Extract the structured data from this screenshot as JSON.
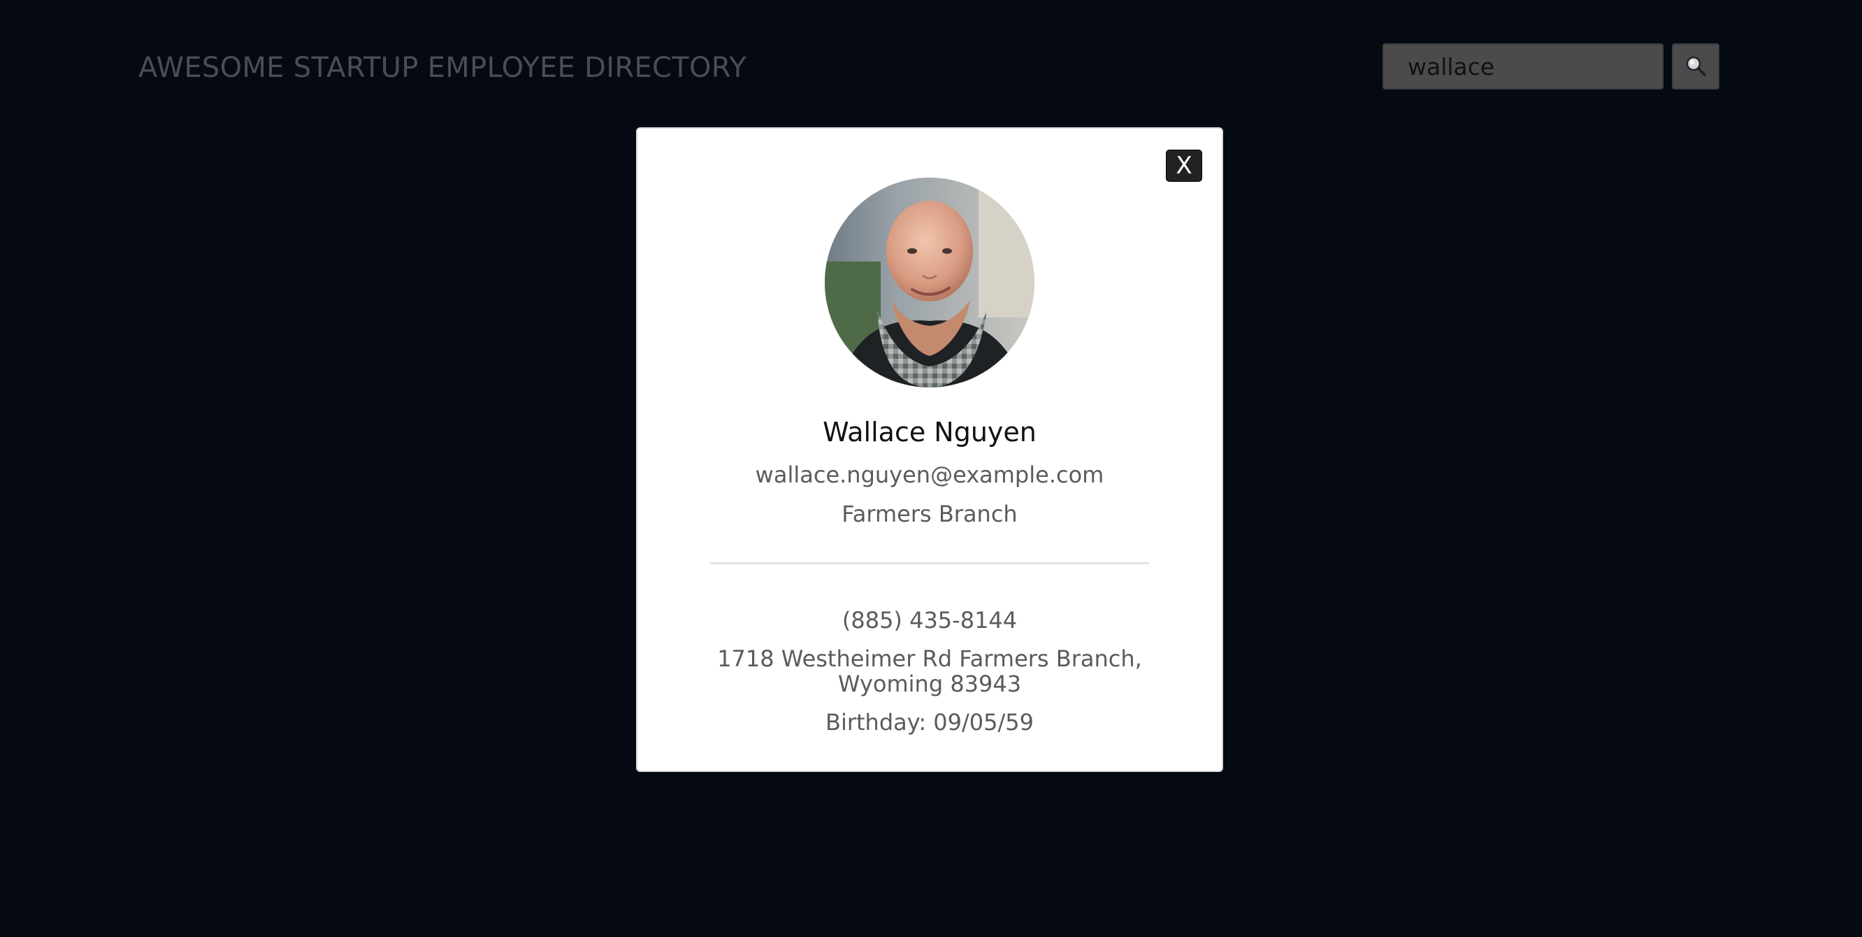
{
  "header": {
    "title": "AWESOME STARTUP EMPLOYEE DIRECTORY"
  },
  "search": {
    "value": "wallace",
    "button_icon": "search-icon"
  },
  "modal": {
    "close_label": "X",
    "employee": {
      "name": "Wallace Nguyen",
      "email": "wallace.nguyen@example.com",
      "city": "Farmers Branch",
      "phone": "(885) 435-8144",
      "address": "1718 Westheimer Rd Farmers Branch, Wyoming 83943",
      "birthday": "Birthday: 09/05/59"
    }
  },
  "colors": {
    "background": "#050912",
    "modal": "#ffffff",
    "close_button": "#222222"
  }
}
